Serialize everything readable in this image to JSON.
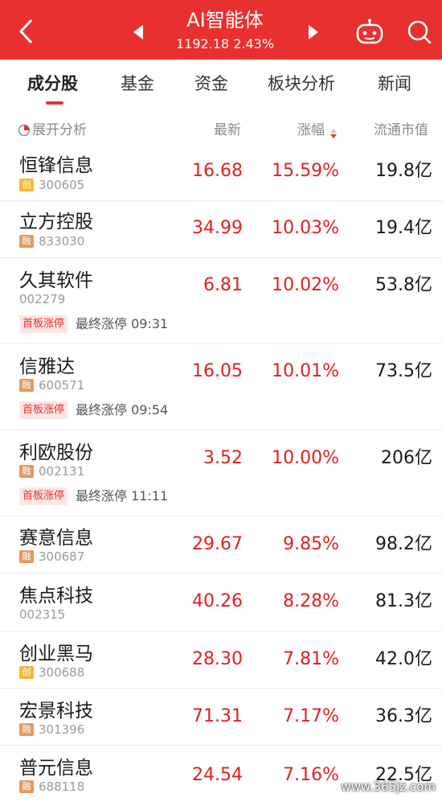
{
  "header": {
    "title": "AI智能体",
    "subtitle": "1192.18  2.43%"
  },
  "tabs": [
    {
      "label": "成分股",
      "active": true
    },
    {
      "label": "基金",
      "active": false
    },
    {
      "label": "资金",
      "active": false
    },
    {
      "label": "板块分析",
      "active": false
    },
    {
      "label": "新闻",
      "active": false
    }
  ],
  "columns": {
    "expand": "展开分析",
    "latest": "最新",
    "change": "涨幅",
    "cap": "流通市值"
  },
  "stocks": [
    {
      "name": "恒锋信息",
      "badge": "创",
      "code": "300605",
      "price": "16.68",
      "change": "15.59%",
      "cap": "19.8亿"
    },
    {
      "name": "立方控股",
      "badge": "融",
      "code": "833030",
      "price": "34.99",
      "change": "10.03%",
      "cap": "19.4亿"
    },
    {
      "name": "久其软件",
      "badge": "",
      "code": "002279",
      "price": "6.81",
      "change": "10.02%",
      "cap": "53.8亿",
      "limit_tag": "首板涨停",
      "limit_text": "最终涨停 09:31"
    },
    {
      "name": "信雅达",
      "badge": "融",
      "code": "600571",
      "price": "16.05",
      "change": "10.01%",
      "cap": "73.5亿",
      "limit_tag": "首板涨停",
      "limit_text": "最终涨停 09:54"
    },
    {
      "name": "利欧股份",
      "badge": "融",
      "code": "002131",
      "price": "3.52",
      "change": "10.00%",
      "cap": "206亿",
      "limit_tag": "首板涨停",
      "limit_text": "最终涨停 11:11"
    },
    {
      "name": "赛意信息",
      "badge": "融",
      "code": "300687",
      "price": "29.67",
      "change": "9.85%",
      "cap": "98.2亿"
    },
    {
      "name": "焦点科技",
      "badge": "",
      "code": "002315",
      "price": "40.26",
      "change": "8.28%",
      "cap": "81.3亿"
    },
    {
      "name": "创业黑马",
      "badge": "创",
      "code": "300688",
      "price": "28.30",
      "change": "7.81%",
      "cap": "42.0亿"
    },
    {
      "name": "宏景科技",
      "badge": "融",
      "code": "301396",
      "price": "71.31",
      "change": "7.17%",
      "cap": "36.3亿"
    },
    {
      "name": "普元信息",
      "badge": "融",
      "code": "688118",
      "price": "24.54",
      "change": "7.16%",
      "cap": "22.5亿"
    }
  ],
  "watermark": "www.365jz.com",
  "colors": {
    "header_bg": "#e8312f",
    "up": "#e02020",
    "badge_rong": "#e39a5e",
    "badge_chuang": "#f2b938"
  },
  "icons": [
    "back-icon",
    "prev-icon",
    "next-icon",
    "robot-icon",
    "search-icon",
    "expand-analysis-icon",
    "sort-icon"
  ]
}
